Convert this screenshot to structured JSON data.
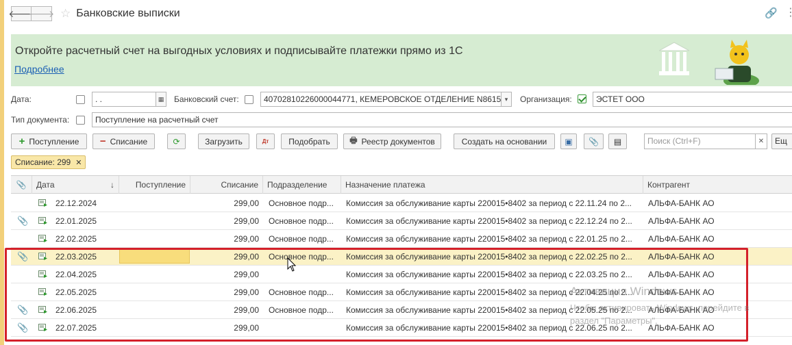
{
  "window": {
    "title": "Банковские выписки"
  },
  "banner": {
    "text": "Откройте расчетный счет на выгодных условиях и подписывайте платежки прямо из 1С",
    "link": "Подробнее"
  },
  "filters": {
    "date_label": "Дата:",
    "date_value": " .  .",
    "bank_account_label": "Банковский счет:",
    "bank_account_value": "40702810226000044771, КЕМЕРОВСКОЕ ОТДЕЛЕНИЕ N8615",
    "org_label": "Организация:",
    "org_value": "ЭСТЕТ ООО",
    "org_checked": true,
    "doc_type_label": "Тип документа:",
    "doc_type_value": "Поступление на расчетный счет"
  },
  "toolbar": {
    "receipt": "Поступление",
    "writeoff": "Списание",
    "load": "Загрузить",
    "pick": "Подобрать",
    "registry": "Реестр документов",
    "create_based": "Создать на основании",
    "search_placeholder": "Поиск (Ctrl+F)",
    "more": "Ещ"
  },
  "active_filter": {
    "label": "Списание: 299"
  },
  "table": {
    "columns": [
      "Дата",
      "Поступление",
      "Списание",
      "Подразделение",
      "Назначение платежа",
      "Контрагент"
    ],
    "sort_indicator": "↓",
    "rows": [
      {
        "attach": false,
        "date": "22.12.2024",
        "income": "",
        "expense": "299,00",
        "dept": "Основное подр...",
        "purpose": "Комиссия за обслуживание карты 220015•8402 за период с 22.11.24 по 2...",
        "counterparty": "АЛЬФА-БАНК АО"
      },
      {
        "attach": true,
        "date": "22.01.2025",
        "income": "",
        "expense": "299,00",
        "dept": "Основное подр...",
        "purpose": "Комиссия за обслуживание карты 220015•8402 за период с 22.12.24 по 2...",
        "counterparty": "АЛЬФА-БАНК АО"
      },
      {
        "attach": false,
        "date": "22.02.2025",
        "income": "",
        "expense": "299,00",
        "dept": "Основное подр...",
        "purpose": "Комиссия за обслуживание карты 220015•8402 за период с 22.01.25 по 2...",
        "counterparty": "АЛЬФА-БАНК АО"
      },
      {
        "attach": true,
        "date": "22.03.2025",
        "income": "",
        "expense": "299,00",
        "dept": "Основное подр...",
        "purpose": "Комиссия за обслуживание карты 220015•8402 за период с 22.02.25 по 2...",
        "counterparty": "АЛЬФА-БАНК АО",
        "selected": true
      },
      {
        "attach": false,
        "date": "22.04.2025",
        "income": "",
        "expense": "299,00",
        "dept": "",
        "purpose": "Комиссия за обслуживание карты 220015•8402 за период с 22.03.25 по 2...",
        "counterparty": "АЛЬФА-БАНК АО"
      },
      {
        "attach": false,
        "date": "22.05.2025",
        "income": "",
        "expense": "299,00",
        "dept": "Основное подр...",
        "purpose": "Комиссия за обслуживание карты 220015•8402 за период с 22.04.25 по 2...",
        "counterparty": "АЛЬФА-БАНК АО"
      },
      {
        "attach": true,
        "date": "22.06.2025",
        "income": "",
        "expense": "299,00",
        "dept": "Основное подр...",
        "purpose": "Комиссия за обслуживание карты 220015•8402 за период с 22.05.25 по 2...",
        "counterparty": "АЛЬФА-БАНК АО"
      },
      {
        "attach": true,
        "date": "22.07.2025",
        "income": "",
        "expense": "299,00",
        "dept": "",
        "purpose": "Комиссия за обслуживание карты 220015•8402 за период с 22.06.25 по 2...",
        "counterparty": "АЛЬФА-БАНК АО"
      }
    ]
  },
  "watermark": {
    "line1": "Активация Windows",
    "line2": "Чтобы активировать Windows, перейдите в",
    "line3": "раздел \"Параметры\"."
  },
  "icons": {
    "back": "arrow-left-icon",
    "forward": "arrow-right-icon",
    "favorite": "star-icon",
    "link": "link-icon",
    "more": "more-vertical-icon",
    "attachment": "paperclip-icon",
    "document": "document-icon"
  },
  "colors": {
    "banner_bg": "#d6ecd2",
    "selected_row": "#fbf2c6",
    "selected_cell": "#f8dd7c",
    "highlight_box": "#d4202a",
    "filter_tag": "#f9e7a8"
  }
}
